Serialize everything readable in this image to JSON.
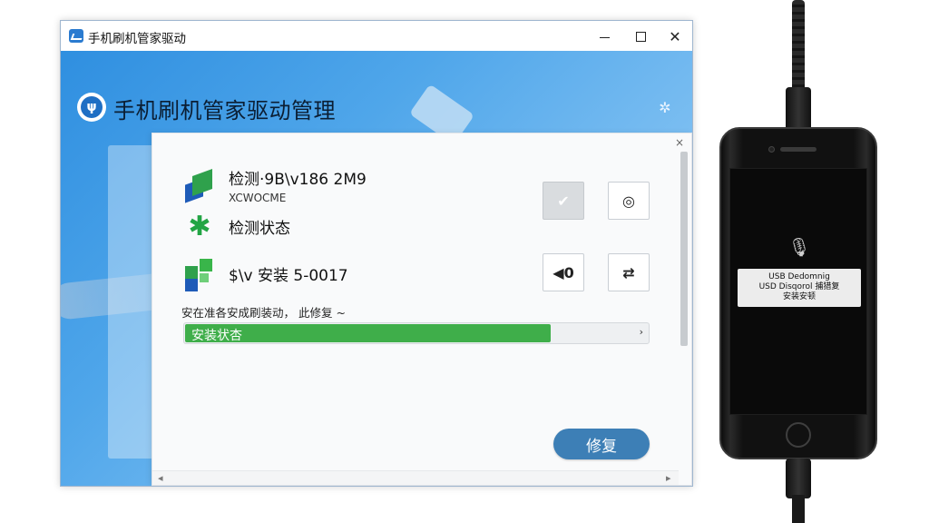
{
  "window": {
    "title": "手机刷机管家驱动",
    "controls": {
      "minimize": "minimize",
      "maximize": "maximize",
      "close": "✕"
    }
  },
  "app": {
    "header_title": "手机刷机管家驱动管理",
    "logo_glyph": "ψ",
    "settings_glyph": "✲"
  },
  "panel": {
    "close_glyph": "×",
    "rows": [
      {
        "main": "检测·9B\\v186 2M9",
        "sub": "XCWOCME",
        "icon": "detect-icon"
      },
      {
        "main": "检测状态",
        "icon": "status-icon"
      },
      {
        "main": "$\\v 安装 5-0017",
        "icon": "install-icon"
      }
    ],
    "buttons": {
      "confirm": "✔",
      "circle": "◎",
      "volume": "◀0",
      "transfer": "⇄"
    },
    "progress": {
      "caption": "安在准各安成刷装动，  此修复 ~",
      "label": "安装状杏",
      "percent": 79,
      "arrow": "›"
    },
    "repair_label": "修复",
    "hscroll": {
      "left": "◂",
      "right": "▸"
    }
  },
  "phone": {
    "usb_glyph": "🎙",
    "dialog_lines": [
      "USB Dedomnig",
      "USD Disqorol 捕猎复",
      "安装安顿"
    ]
  },
  "colors": {
    "header_gradient_start": "#2f8fe0",
    "progress_fill": "#3fae4a",
    "repair_button": "#3d7fb6"
  }
}
